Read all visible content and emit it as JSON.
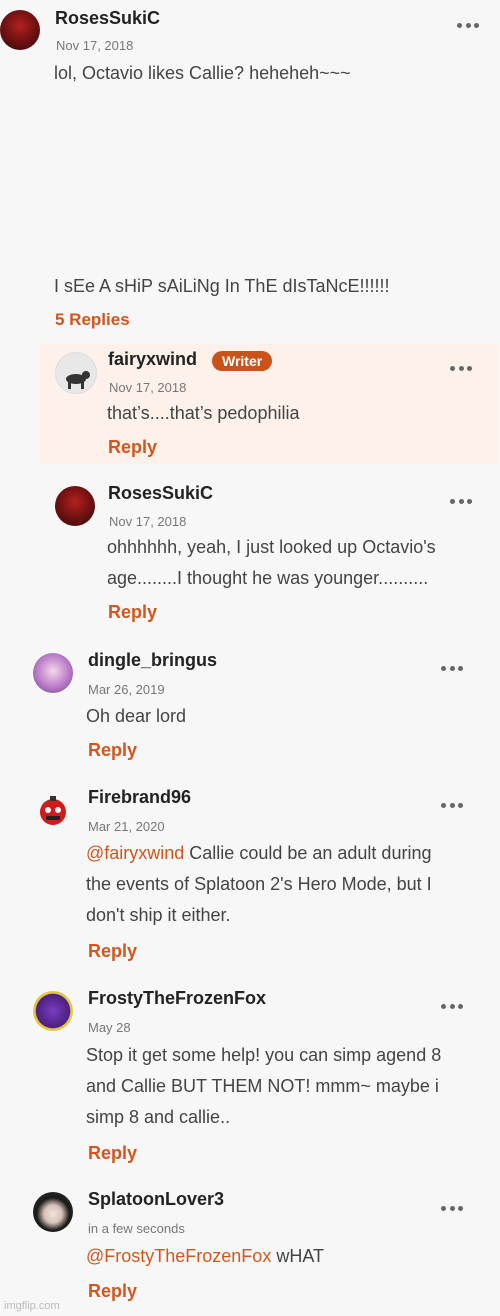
{
  "comments": [
    {
      "username": "RosesSukiC",
      "date": "Nov 17, 2018",
      "lines": [
        "lol, Octavio likes Callie? heheheh~~~",
        "I sEe A sHiP sAiLiNg In ThE dIsTaNcE!!!!!!"
      ],
      "replies_label": "5 Replies"
    },
    {
      "username": "fairyxwind",
      "badge": "Writer",
      "date": "Nov 17, 2018",
      "lines": [
        "that’s....that’s pedophilia"
      ],
      "reply_label": "Reply"
    },
    {
      "username": "RosesSukiC",
      "date": "Nov 17, 2018",
      "lines": [
        "ohhhhhh, yeah, I just looked up Octavio's",
        "age........I thought he was younger.........."
      ],
      "reply_label": "Reply"
    },
    {
      "username": "dingle_bringus",
      "date": "Mar 26, 2019",
      "lines": [
        "Oh dear lord"
      ],
      "reply_label": "Reply"
    },
    {
      "username": "Firebrand96",
      "date": "Mar 21, 2020",
      "mention": "@fairyxwind",
      "lines": [
        " Callie could be an adult during",
        "the events of Splatoon 2's Hero Mode, but I",
        "don't ship it either."
      ],
      "reply_label": "Reply"
    },
    {
      "username": "FrostyTheFrozenFox",
      "date": "May 28",
      "lines": [
        "Stop it get some help! you can simp agend 8",
        "and Callie BUT THEM NOT! mmm~ maybe i",
        "simp 8 and callie.."
      ],
      "reply_label": "Reply"
    },
    {
      "username": "SplatoonLover3",
      "date": "in a few seconds",
      "mention": "@FrostyTheFrozenFox",
      "lines": [
        " wHAT"
      ],
      "reply_label": "Reply"
    }
  ],
  "watermark": "imgflip.com",
  "colors": {
    "accent": "#d2561d",
    "badge": "#c9541b",
    "highlight": "#fdf1ea"
  },
  "icons": {
    "menu": "more-dots-icon"
  }
}
